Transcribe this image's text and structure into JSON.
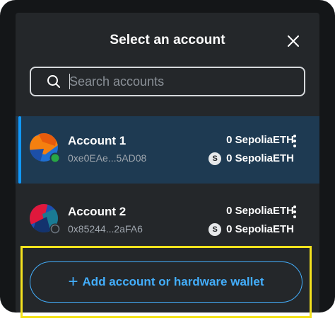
{
  "header": {
    "title": "Select an account"
  },
  "icons": {
    "close": "close-icon",
    "search": "search-icon",
    "more": "kebab-menu-icon"
  },
  "search": {
    "placeholder": "Search accounts",
    "value": ""
  },
  "accounts": [
    {
      "name": "Account 1",
      "address": "0xe0EAe...5AD08",
      "balance_primary": "0 SepoliaETH",
      "balance_secondary": "0 SepoliaETH",
      "network_badge": "S",
      "selected": true
    },
    {
      "name": "Account 2",
      "address": "0x85244...2aFA6",
      "balance_primary": "0 SepoliaETH",
      "balance_secondary": "0 SepoliaETH",
      "network_badge": "S",
      "selected": false
    }
  ],
  "footer": {
    "add_label": "Add account or hardware wallet",
    "add_icon": "+"
  },
  "colors": {
    "accent": "#43aefc",
    "selected_bar": "#1098fc",
    "selected_row": "#1e3a52",
    "panel": "#24272a",
    "highlight": "#f4e21e",
    "connected_dot": "#28a745"
  }
}
